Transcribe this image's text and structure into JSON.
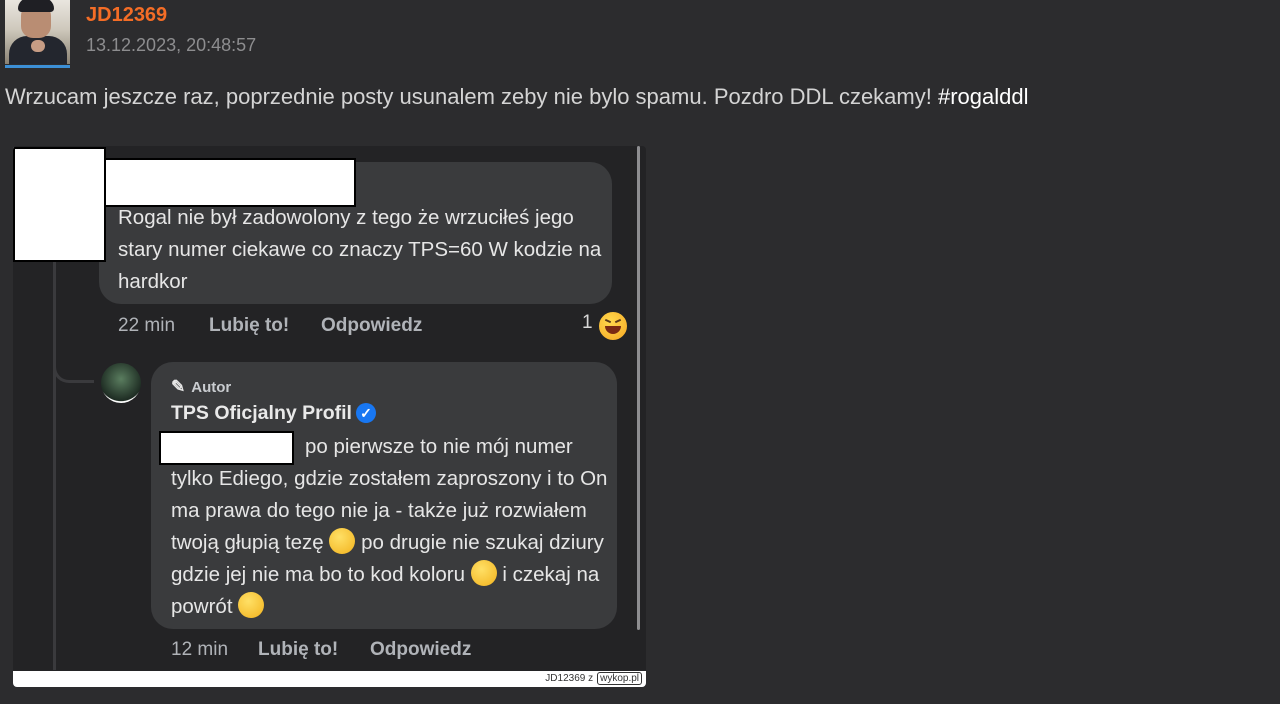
{
  "post": {
    "username": "JD12369",
    "timestamp": "13.12.2023, 20:48:57",
    "text": "Wrzucam jeszcze raz, poprzednie posty usunalem zeby nie bylo spamu. Pozdro DDL czekamy! ",
    "hashtag": "#rogalddl"
  },
  "screenshot": {
    "comment1": {
      "text": "Rogal nie był zadowolony z tego że wrzuciłeś jego stary numer ciekawe co znaczy TPS=60 W kodzie na hardkor",
      "time": "22 min",
      "like": "Lubię to!",
      "reply": "Odpowiedz",
      "reaction_count": "1",
      "reaction_icon": "laughing-emoji"
    },
    "comment2": {
      "badge": "Autor",
      "badge_icon": "microphone-icon",
      "page_name": "TPS Oficjalny Profil",
      "verified_icon": "verified-check-icon",
      "text_part1": "po pierwsze to nie mój numer tylko Ediego, gdzie zostałem zaproszony i to On ma prawa do tego nie ja - także już rozwiałem twoją głupią tezę ",
      "emoji1": "🙂",
      "text_part2": " po drugie nie szukaj dziury gdzie jej nie ma bo to kod koloru ",
      "emoji2": "😉",
      "text_part3": " i czekaj na powrót ",
      "emoji3": "🤫",
      "time": "12 min",
      "like": "Lubię to!",
      "reply": "Odpowiedz"
    },
    "watermark": {
      "author": "JD12369",
      "sep": "z",
      "site": "wykop.pl"
    }
  },
  "colors": {
    "background": "#2c2c2e",
    "username": "#f46d26",
    "bubble": "#3a3b3d",
    "verified": "#1877f2"
  }
}
